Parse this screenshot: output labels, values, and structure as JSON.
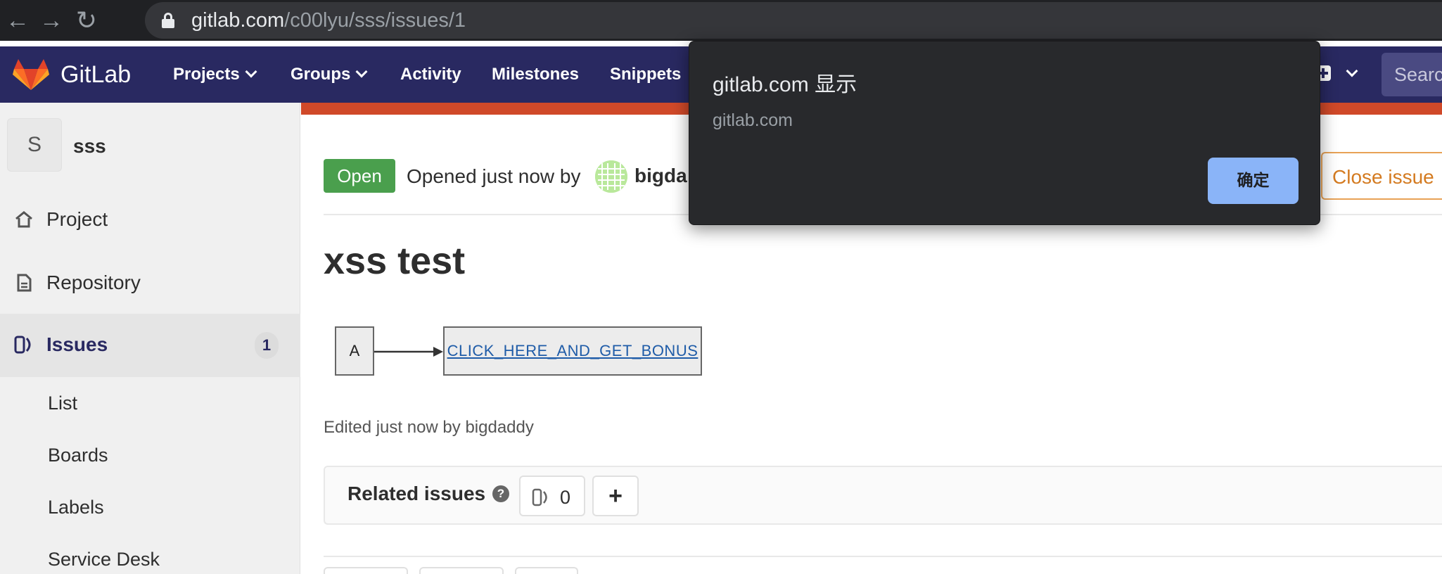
{
  "browser": {
    "url_host": "gitlab.com",
    "url_path": "/c00lyu/sss/issues/1"
  },
  "navbar": {
    "brand": "GitLab",
    "items": [
      {
        "label": "Projects"
      },
      {
        "label": "Groups"
      },
      {
        "label": "Activity"
      },
      {
        "label": "Milestones"
      },
      {
        "label": "Snippets"
      }
    ],
    "search_placeholder": "Search"
  },
  "sidebar": {
    "project_initial": "S",
    "project_name": "sss",
    "items": [
      {
        "label": "Project"
      },
      {
        "label": "Repository"
      },
      {
        "label": "Issues",
        "badge": "1"
      }
    ],
    "subitems": [
      {
        "label": "List"
      },
      {
        "label": "Boards"
      },
      {
        "label": "Labels"
      },
      {
        "label": "Service Desk"
      }
    ]
  },
  "issue": {
    "status": "Open",
    "opened_text": "Opened just now by",
    "author_partial": "bigda",
    "close_button": "Close issue",
    "title": "xss test",
    "diagram": {
      "node_a": "A",
      "link_text": "CLICK_HERE_AND_GET_BONUS"
    },
    "edited_text": "Edited just now by bigdaddy"
  },
  "related": {
    "label": "Related issues",
    "help_glyph": "?",
    "count": "0",
    "add_glyph": "+"
  },
  "dialog": {
    "title": "gitlab.com 显示",
    "message": "gitlab.com",
    "ok_label": "确定"
  },
  "colors": {
    "navbar": "#292961",
    "accent_bar": "#d04929",
    "open_badge": "#4a9f4d",
    "dialog_bg": "#28292c",
    "dialog_button": "#8ab4f8"
  }
}
